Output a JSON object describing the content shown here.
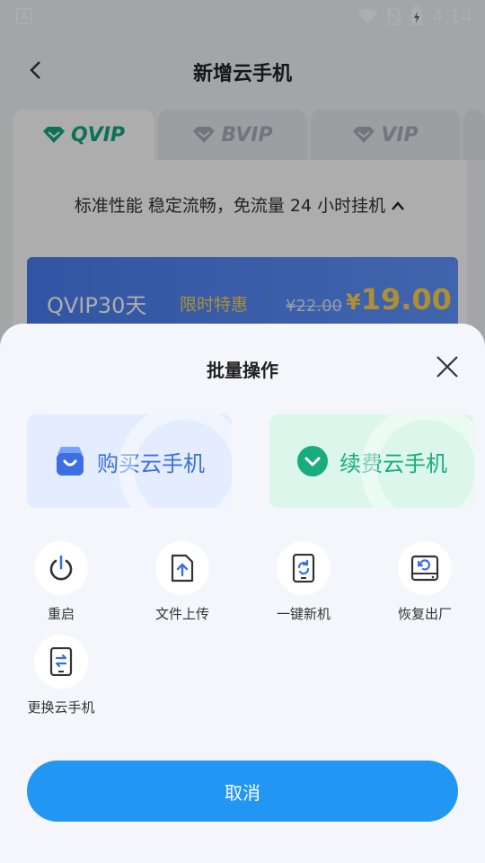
{
  "status_bar": {
    "time": "4:14",
    "left_icon_letter": "A",
    "icons": [
      "wifi-icon",
      "no-sim-icon",
      "battery-charging-icon"
    ]
  },
  "header": {
    "title": "新增云手机"
  },
  "tabs": [
    {
      "label": "QVIP",
      "active": true
    },
    {
      "label": "BVIP",
      "active": false
    },
    {
      "label": "VIP",
      "active": false
    }
  ],
  "content": {
    "description": "标准性能 稳定流畅，免流量 24 小时挂机",
    "plan": {
      "name": "QVIP30天",
      "tag": "限时特惠",
      "old_price": "¥22.00",
      "currency": "¥",
      "price": "19.00"
    }
  },
  "sheet": {
    "title": "批量操作",
    "cards": [
      {
        "label": "购买云手机",
        "icon": "shopping-bag-icon",
        "color": "#3d6fe0"
      },
      {
        "label": "续费云手机",
        "icon": "renew-chevron-icon",
        "color": "#19ad7e"
      }
    ],
    "actions": [
      {
        "label": "重启",
        "icon": "power-icon"
      },
      {
        "label": "文件上传",
        "icon": "file-upload-icon"
      },
      {
        "label": "一键新机",
        "icon": "phone-refresh-icon"
      },
      {
        "label": "恢复出厂",
        "icon": "factory-reset-icon"
      },
      {
        "label": "更换云手机",
        "icon": "phone-swap-icon"
      }
    ],
    "cancel_label": "取消"
  },
  "colors": {
    "primary": "#2196f3",
    "active_tab": "#12a879",
    "price": "#ffd34d"
  }
}
